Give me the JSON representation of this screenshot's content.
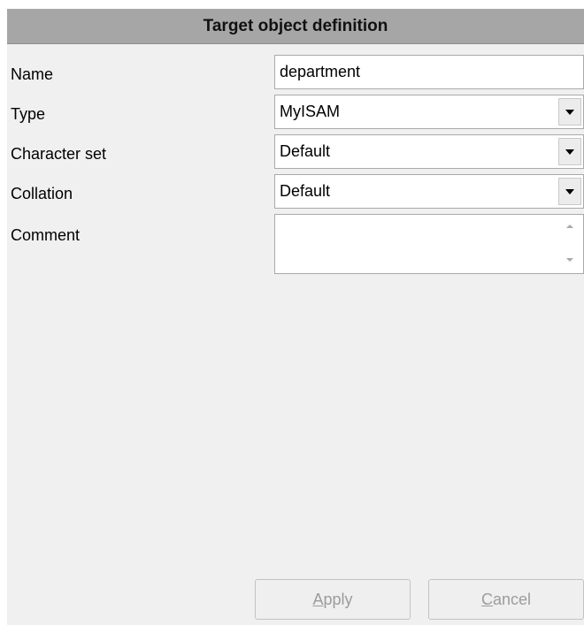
{
  "panel": {
    "title": "Target object definition"
  },
  "form": {
    "name": {
      "label": "Name",
      "value": "department"
    },
    "type": {
      "label": "Type",
      "value": "MyISAM"
    },
    "charset": {
      "label": "Character set",
      "value": "Default"
    },
    "collation": {
      "label": "Collation",
      "value": "Default"
    },
    "comment": {
      "label": "Comment",
      "value": ""
    }
  },
  "buttons": {
    "apply": {
      "mnemonic": "A",
      "rest": "pply",
      "enabled": false
    },
    "cancel": {
      "mnemonic": "C",
      "rest": "ancel",
      "enabled": false
    }
  },
  "icons": {
    "dropdown": "chevron-down-icon",
    "scroll_up": "scroll-up-arrow-icon",
    "scroll_down": "scroll-down-arrow-icon"
  },
  "colors": {
    "header_bg": "#a6a6a6",
    "panel_bg": "#f0f0f0",
    "disabled_text": "#9c9c9c"
  }
}
